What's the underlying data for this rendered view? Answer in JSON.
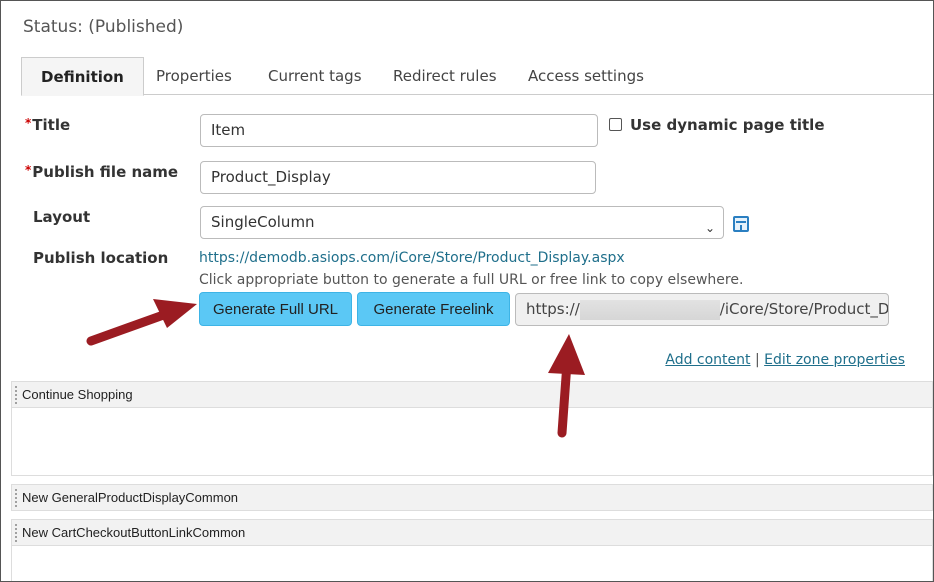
{
  "status": "Status: (Published)",
  "tabs": [
    {
      "label": "Definition"
    },
    {
      "label": "Properties"
    },
    {
      "label": "Current tags"
    },
    {
      "label": "Redirect rules"
    },
    {
      "label": "Access settings"
    }
  ],
  "form": {
    "required_mark": "*",
    "title_label": "Title",
    "title_value": "Item",
    "dynamic_title_label": "Use dynamic page title",
    "dynamic_title_checked": false,
    "publish_file_label": "Publish file name",
    "publish_file_value": "Product_Display",
    "layout_label": "Layout",
    "layout_value": "SingleColumn",
    "layout_icon": "layout-icon",
    "publish_location_label": "Publish location",
    "publish_location_url": "https://demodb.asiops.com/iCore/Store/Product_Display.aspx",
    "hint": "Click appropriate button to generate a full URL or free link to copy elsewhere.",
    "generate_full_url": "Generate Full URL",
    "generate_freelink": "Generate Freelink",
    "url_prefix": "https://",
    "url_suffix": "/iCore/Store/Product_D"
  },
  "zone_links": {
    "add_content": "Add content",
    "separator": "|",
    "edit_zone_properties": "Edit zone properties"
  },
  "zones": [
    {
      "title": "Continue Shopping"
    },
    {
      "title": "New GeneralProductDisplayCommon"
    },
    {
      "title": "New CartCheckoutButtonLinkCommon"
    }
  ],
  "colors": {
    "button": "#5bc8f5",
    "link": "#1f6f8b",
    "arrow": "#9b1c22",
    "required": "#cc0000"
  }
}
